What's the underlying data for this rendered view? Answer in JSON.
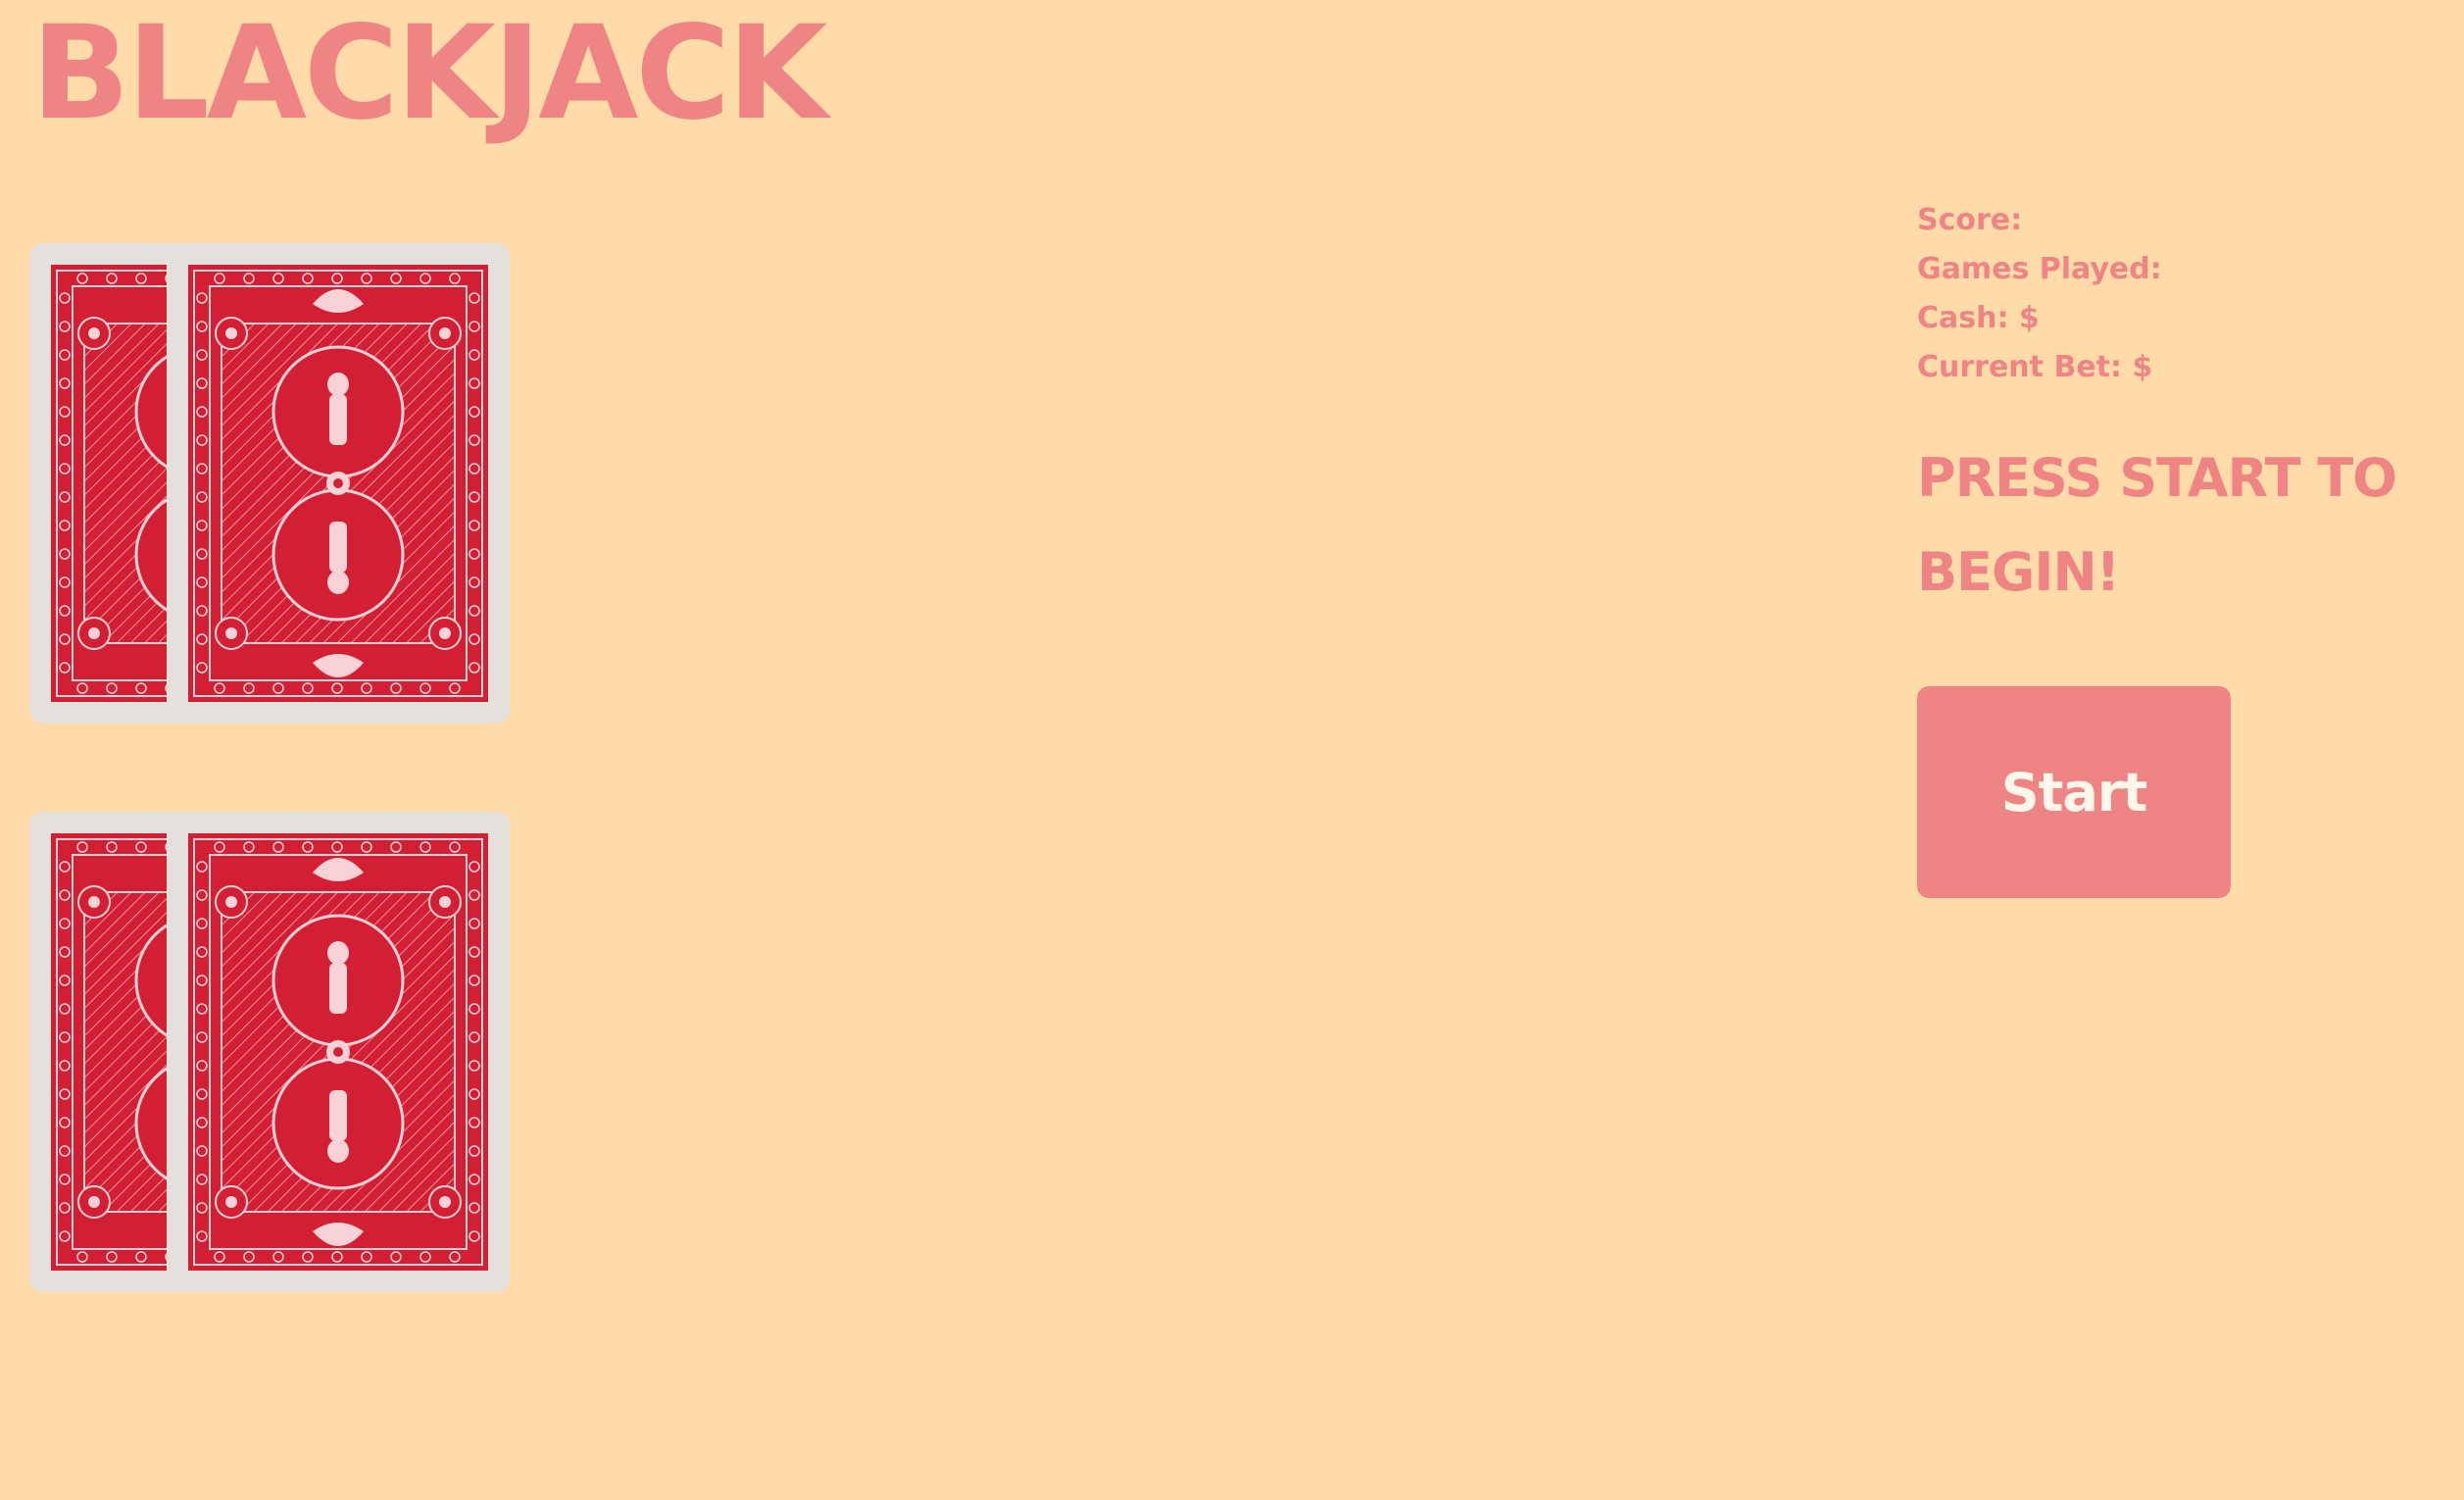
{
  "app": {
    "title": "BLACKJACK"
  },
  "hands": {
    "dealer": {
      "cards": [
        {
          "face": "back",
          "icon": "card-back-icon"
        },
        {
          "face": "back",
          "icon": "card-back-icon"
        }
      ]
    },
    "player": {
      "cards": [
        {
          "face": "back",
          "icon": "card-back-icon"
        },
        {
          "face": "back",
          "icon": "card-back-icon"
        }
      ]
    }
  },
  "stats": {
    "score_label": "Score:",
    "games_played_label": "Games Played:",
    "cash_label": "Cash: $",
    "current_bet_label": "Current Bet: $"
  },
  "message": {
    "line1": "PRESS START TO",
    "line2": "BEGIN!"
  },
  "controls": {
    "start_label": "Start"
  },
  "colors": {
    "background": "#fedba9",
    "accent": "#ef8484",
    "card_red": "#d31f33",
    "card_border": "#e4e1dd",
    "button_text": "#fff8ea"
  }
}
